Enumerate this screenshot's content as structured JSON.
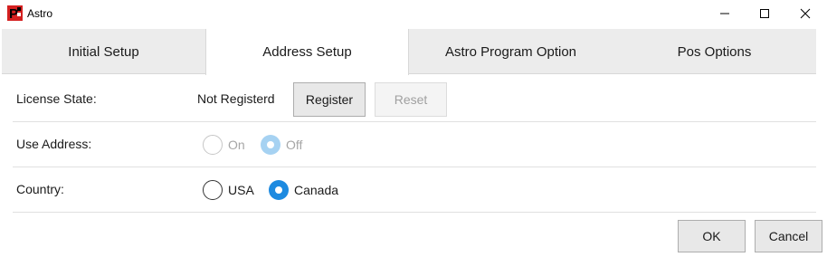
{
  "window": {
    "title": "Astro",
    "icon_text": "P"
  },
  "tabs": [
    {
      "label": "Initial Setup",
      "active": false
    },
    {
      "label": "Address Setup",
      "active": true
    },
    {
      "label": "Astro Program Option",
      "active": false
    },
    {
      "label": "Pos Options",
      "active": false
    }
  ],
  "license": {
    "label": "License State:",
    "status": "Not Registerd",
    "register_label": "Register",
    "reset_label": "Reset"
  },
  "use_address": {
    "label": "Use Address:",
    "options": [
      {
        "label": "On",
        "checked": false
      },
      {
        "label": "Off",
        "checked": true
      }
    ],
    "enabled": false
  },
  "country": {
    "label": "Country:",
    "options": [
      {
        "label": "USA",
        "checked": false
      },
      {
        "label": "Canada",
        "checked": true
      }
    ]
  },
  "footer": {
    "ok_label": "OK",
    "cancel_label": "Cancel"
  },
  "colors": {
    "accent": "#1d8ae0",
    "app_icon": "#d42020"
  }
}
